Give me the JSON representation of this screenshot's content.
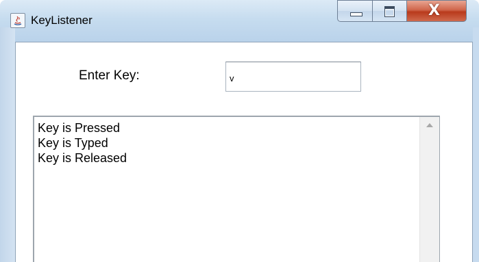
{
  "window": {
    "title": "KeyListener",
    "app_icon": "java-icon",
    "caption_buttons": {
      "minimize_icon": "minimize-icon",
      "maximize_icon": "maximize-icon",
      "close_icon": "close-icon",
      "close_glyph": "X"
    }
  },
  "form": {
    "key_label": "Enter Key:",
    "key_value": "v"
  },
  "log": {
    "lines": [
      "Key is Pressed",
      "Key is Typed",
      "Key is Released"
    ]
  },
  "scrollbar": {
    "up_icon": "scroll-up-arrow-icon"
  },
  "colors": {
    "titlebar": "#c6dcef",
    "close_button": "#c7452a"
  }
}
